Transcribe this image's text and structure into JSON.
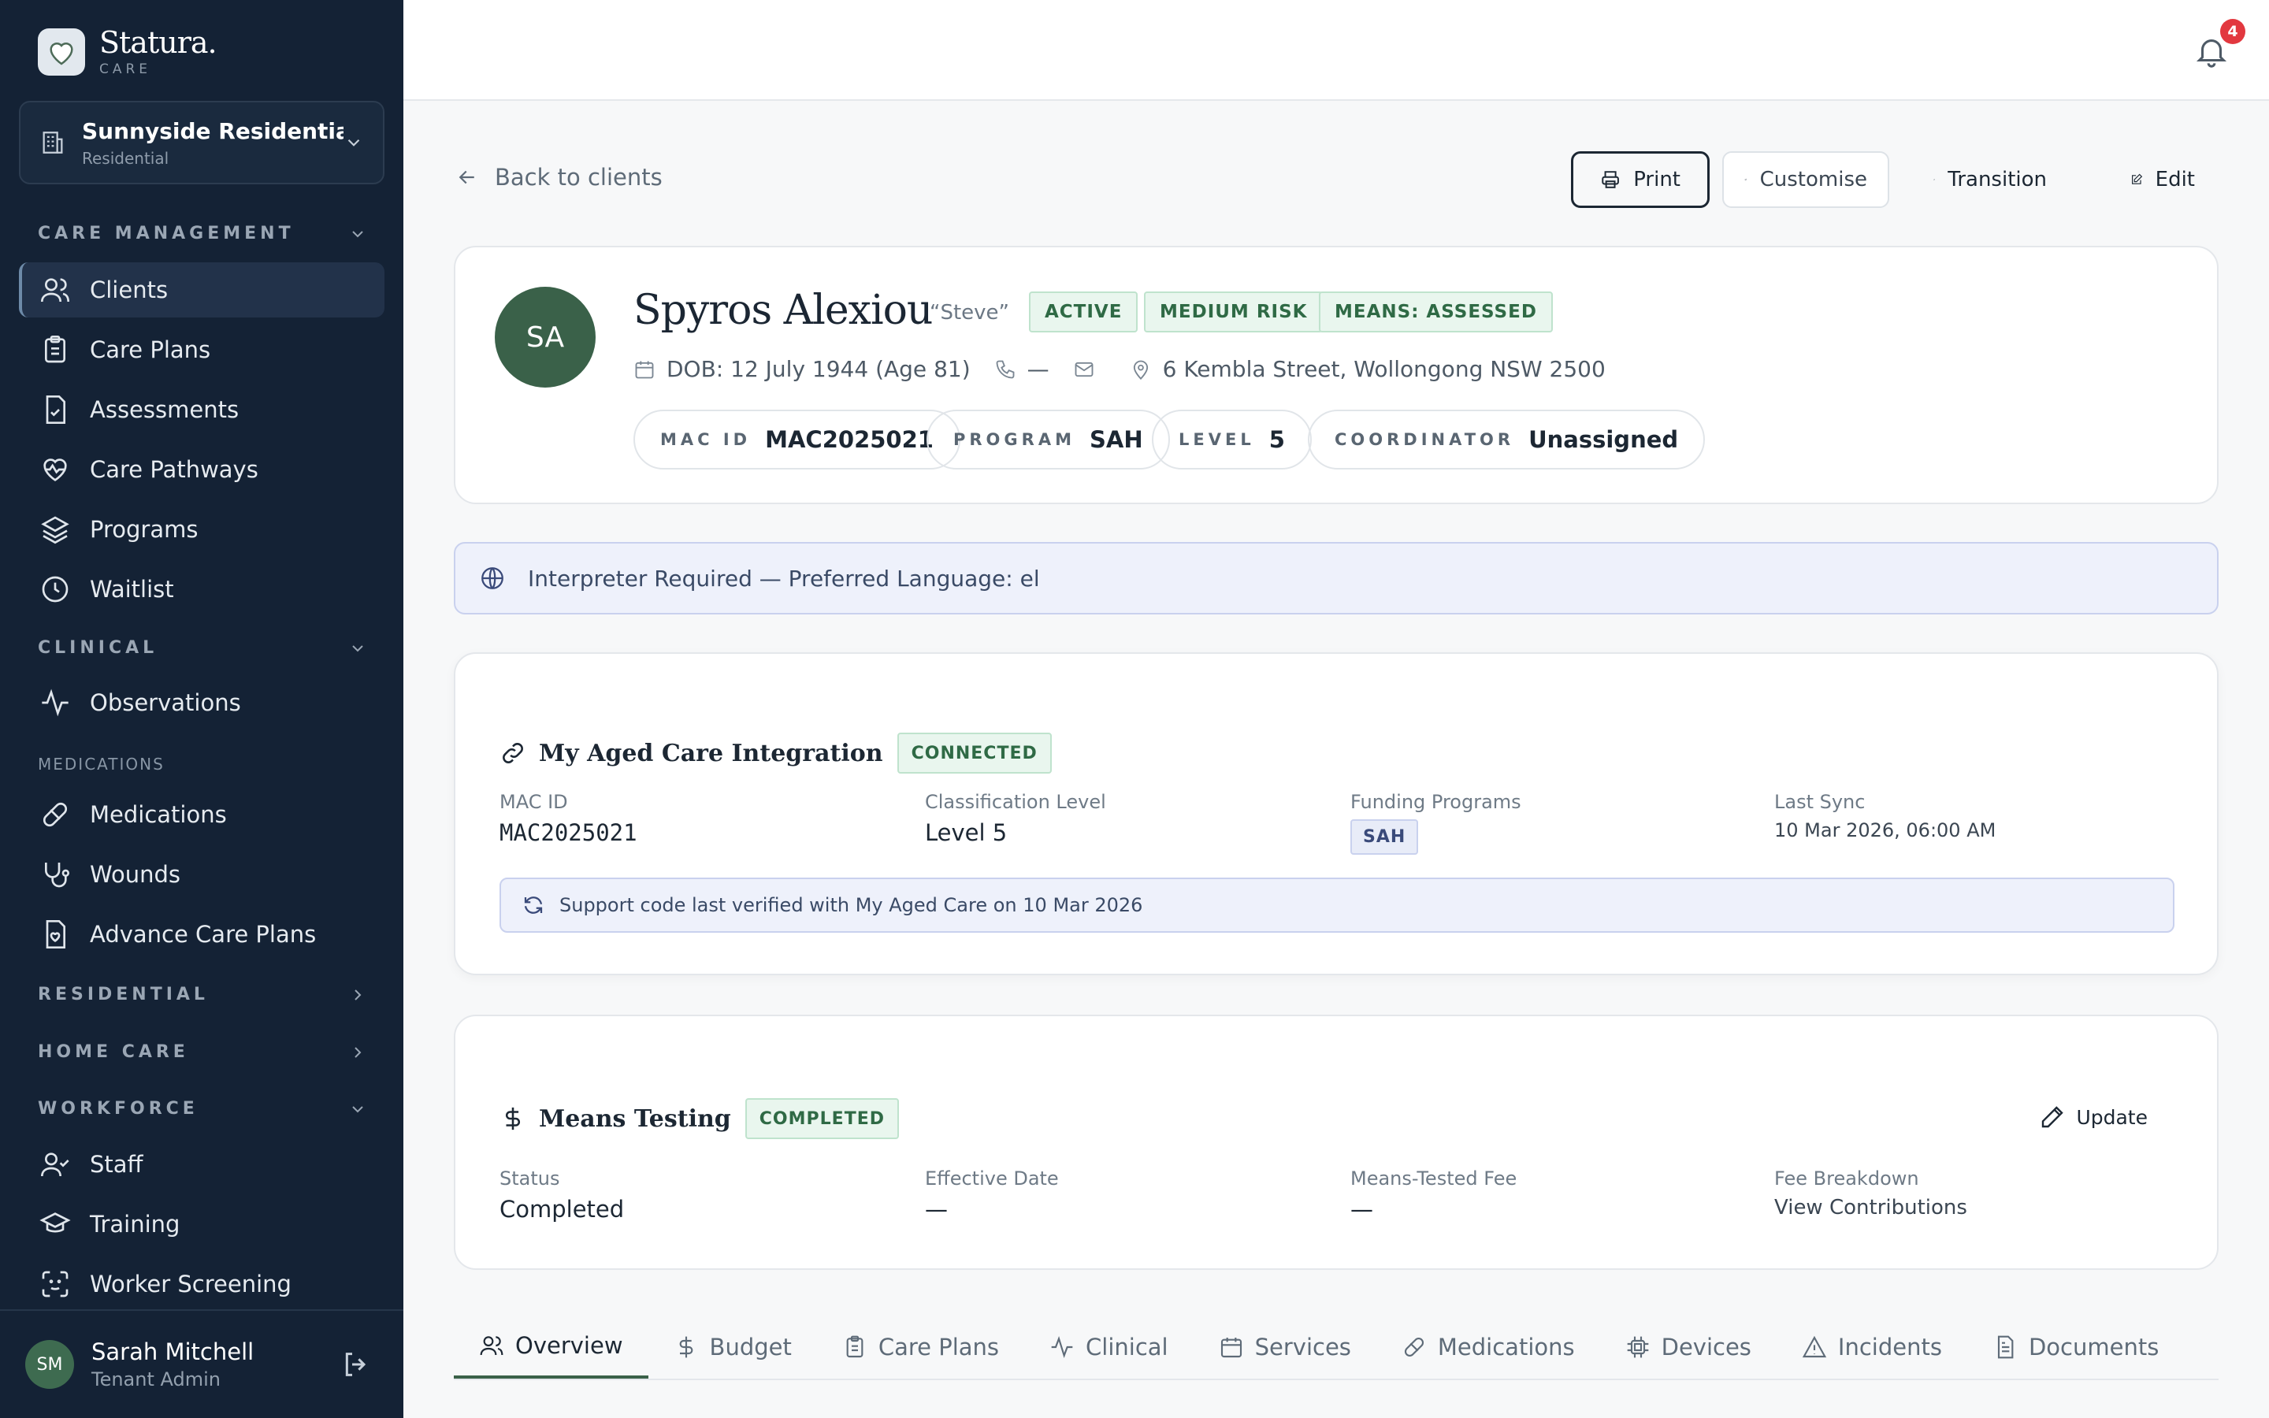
{
  "brand": {
    "name": "Statura.",
    "sub": "CARE"
  },
  "facility": {
    "name": "Sunnyside Residentia...",
    "type": "Residential"
  },
  "sidebar": {
    "care_management": "CARE MANAGEMENT",
    "clients": "Clients",
    "care_plans": "Care Plans",
    "assessments": "Assessments",
    "care_pathways": "Care Pathways",
    "programs": "Programs",
    "waitlist": "Waitlist",
    "clinical": "CLINICAL",
    "observations": "Observations",
    "medications_section": "MEDICATIONS",
    "medications": "Medications",
    "wounds": "Wounds",
    "advance_care_plans": "Advance Care Plans",
    "residential": "RESIDENTIAL",
    "home_care": "HOME CARE",
    "workforce": "WORKFORCE",
    "staff": "Staff",
    "training": "Training",
    "worker_screening": "Worker Screening"
  },
  "user": {
    "initials": "SM",
    "name": "Sarah Mitchell",
    "role": "Tenant Admin"
  },
  "notifications": {
    "count": "4"
  },
  "header": {
    "back": "Back to clients",
    "print": "Print",
    "customise": "Customise",
    "transition": "Transition",
    "edit": "Edit"
  },
  "client": {
    "initials": "SA",
    "name": "Spyros Alexiou",
    "nickname": "“Steve”",
    "status": "ACTIVE",
    "risk": "MEDIUM RISK",
    "means": "MEANS: ASSESSED",
    "dob": "DOB: 12 July 1944 (Age 81)",
    "phone": "—",
    "address": "6 Kembla Street, Wollongong NSW 2500",
    "mac_label": "MAC ID",
    "mac_value": "MAC2025021",
    "program_label": "PROGRAM",
    "program_value": "SAH",
    "level_label": "LEVEL",
    "level_value": "5",
    "coordinator_label": "COORDINATOR",
    "coordinator_value": "Unassigned"
  },
  "interpreter": "Interpreter Required — Preferred Language: el",
  "mac": {
    "title": "My Aged Care Integration",
    "status": "CONNECTED",
    "id_label": "MAC ID",
    "id_value": "MAC2025021",
    "class_label": "Classification Level",
    "class_value": "Level 5",
    "funding_label": "Funding Programs",
    "funding_value": "SAH",
    "sync_label": "Last Sync",
    "sync_value": "10 Mar 2026, 06:00 AM",
    "support": "Support code last verified with My Aged Care on 10 Mar 2026"
  },
  "means": {
    "title": "Means Testing",
    "status": "COMPLETED",
    "update": "Update",
    "status_label": "Status",
    "status_value": "Completed",
    "effective_label": "Effective Date",
    "effective_value": "—",
    "fee_label": "Means-Tested Fee",
    "fee_value": "—",
    "breakdown_label": "Fee Breakdown",
    "breakdown_value": "View Contributions"
  },
  "tabs": {
    "overview": "Overview",
    "budget": "Budget",
    "care_plans": "Care Plans",
    "clinical": "Clinical",
    "services": "Services",
    "medications": "Medications",
    "devices": "Devices",
    "incidents": "Incidents",
    "documents": "Documents"
  }
}
